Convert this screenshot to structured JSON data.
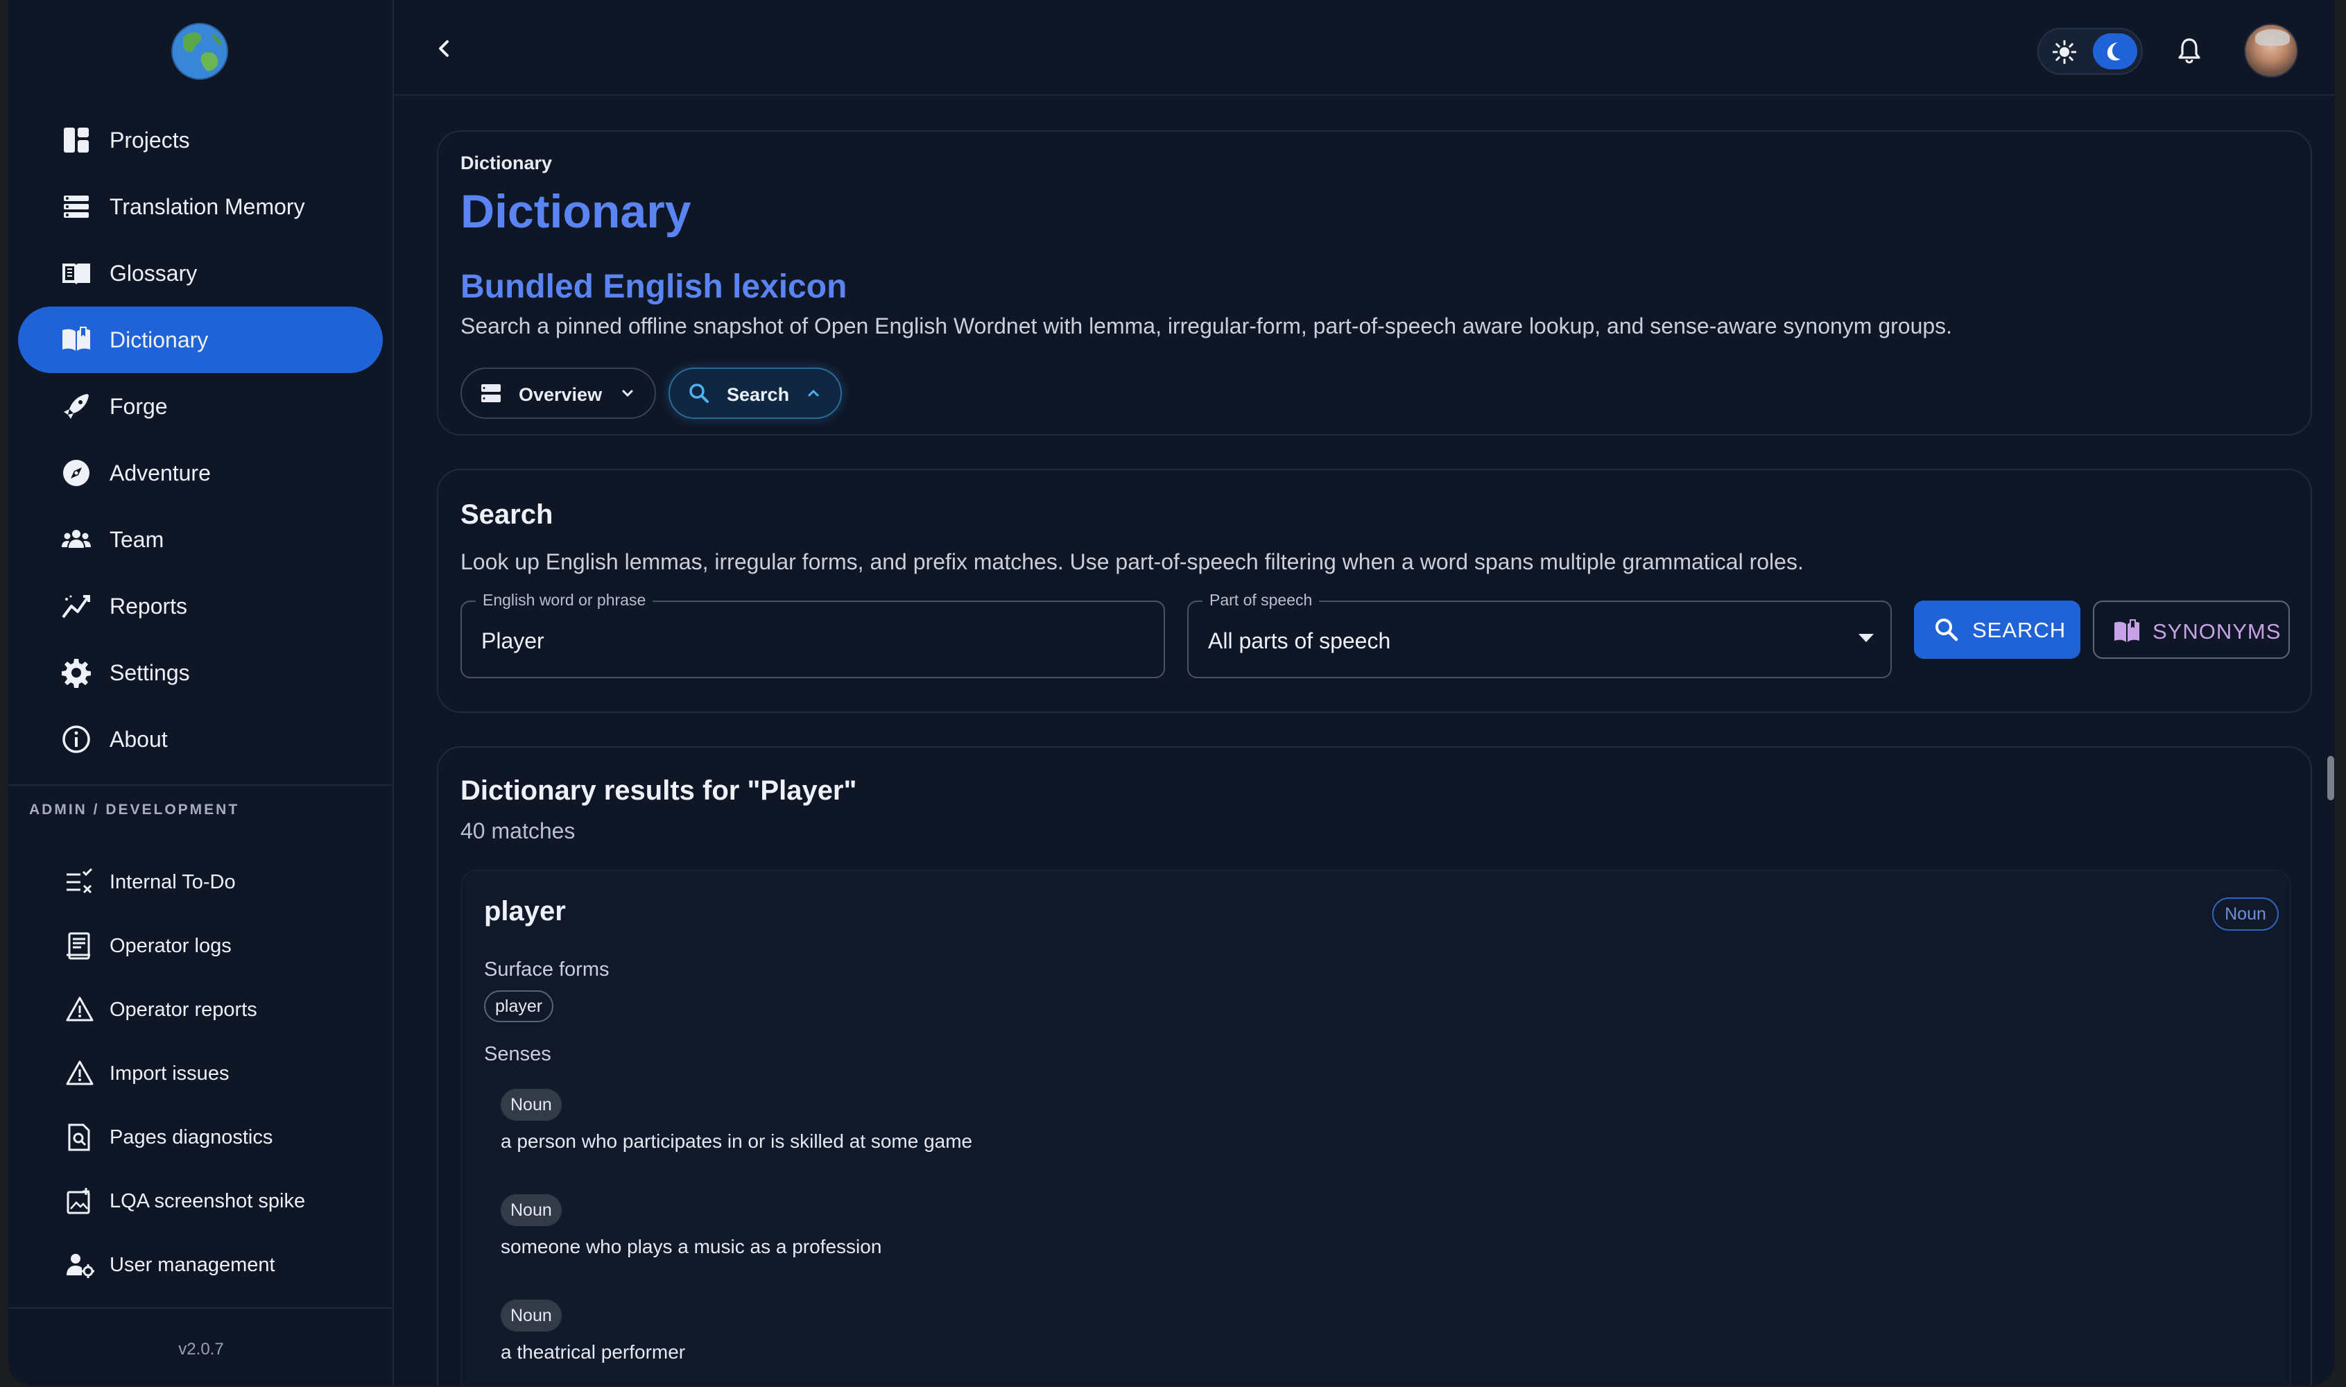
{
  "sidebar": {
    "logo": "globe-icon",
    "items": [
      {
        "label": "Projects",
        "icon": "projects-icon"
      },
      {
        "label": "Translation Memory",
        "icon": "translation-memory-icon"
      },
      {
        "label": "Glossary",
        "icon": "glossary-icon"
      },
      {
        "label": "Dictionary",
        "icon": "dictionary-icon",
        "active": true
      },
      {
        "label": "Forge",
        "icon": "forge-icon"
      },
      {
        "label": "Adventure",
        "icon": "compass-icon"
      },
      {
        "label": "Team",
        "icon": "team-icon"
      },
      {
        "label": "Reports",
        "icon": "reports-icon"
      },
      {
        "label": "Settings",
        "icon": "gear-icon"
      },
      {
        "label": "About",
        "icon": "info-icon"
      }
    ],
    "admin_label": "ADMIN / DEVELOPMENT",
    "admin_items": [
      {
        "label": "Internal To-Do",
        "icon": "todo-icon"
      },
      {
        "label": "Operator logs",
        "icon": "logs-icon"
      },
      {
        "label": "Operator reports",
        "icon": "warning-icon"
      },
      {
        "label": "Import issues",
        "icon": "warning-icon"
      },
      {
        "label": "Pages diagnostics",
        "icon": "diagnostics-icon"
      },
      {
        "label": "LQA screenshot spike",
        "icon": "screenshot-icon"
      },
      {
        "label": "User management",
        "icon": "user-management-icon"
      }
    ],
    "version": "v2.0.7"
  },
  "topbar": {
    "back_icon": "chevron-left-icon",
    "theme": "dark",
    "accent": "#1f63d6"
  },
  "hero": {
    "breadcrumb": "Dictionary",
    "title": "Dictionary",
    "subtitle": "Bundled English lexicon",
    "description": "Search a pinned offline snapshot of Open English Wordnet with lemma, irregular-form, part-of-speech aware lookup, and sense-aware synonym groups.",
    "chips": {
      "overview": "Overview",
      "search": "Search"
    }
  },
  "search": {
    "title": "Search",
    "description": "Look up English lemmas, irregular forms, and prefix matches. Use part-of-speech filtering when a word spans multiple grammatical roles.",
    "word_label": "English word or phrase",
    "word_value": "Player",
    "pos_label": "Part of speech",
    "pos_value": "All parts of speech",
    "search_button": "SEARCH",
    "synonyms_button": "SYNONYMS"
  },
  "results": {
    "title": "Dictionary results for \"Player\"",
    "count": "40 matches",
    "entry": {
      "word": "player",
      "badge": "Noun",
      "surface_forms_label": "Surface forms",
      "surface_forms": [
        "player"
      ],
      "senses_label": "Senses",
      "senses": [
        {
          "pos": "Noun",
          "definition": "a person who participates in or is skilled at some game"
        },
        {
          "pos": "Noun",
          "definition": "someone who plays a music as a profession"
        },
        {
          "pos": "Noun",
          "definition": "a theatrical performer"
        }
      ]
    }
  }
}
